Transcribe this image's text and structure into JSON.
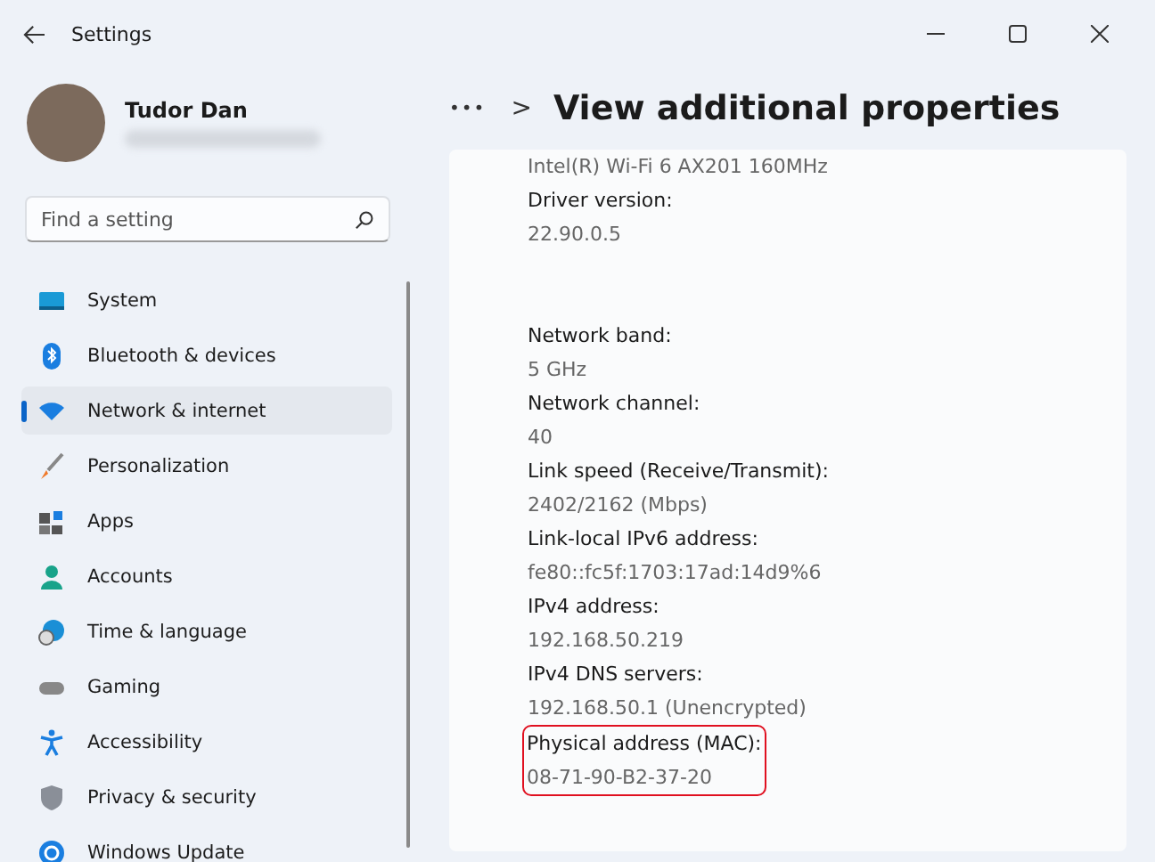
{
  "window": {
    "title": "Settings"
  },
  "profile": {
    "name": "Tudor Dan"
  },
  "search": {
    "placeholder": "Find a setting"
  },
  "nav": [
    {
      "label": "System",
      "selected": false
    },
    {
      "label": "Bluetooth & devices",
      "selected": false
    },
    {
      "label": "Network & internet",
      "selected": true
    },
    {
      "label": "Personalization",
      "selected": false
    },
    {
      "label": "Apps",
      "selected": false
    },
    {
      "label": "Accounts",
      "selected": false
    },
    {
      "label": "Time & language",
      "selected": false
    },
    {
      "label": "Gaming",
      "selected": false
    },
    {
      "label": "Accessibility",
      "selected": false
    },
    {
      "label": "Privacy & security",
      "selected": false
    },
    {
      "label": "Windows Update",
      "selected": false
    }
  ],
  "breadcrumb": {
    "overflow": "•••",
    "separator": ">",
    "title": "View additional properties"
  },
  "property_groups": [
    [
      {
        "value": "Intel(R) Wi-Fi 6 AX201 160MHz",
        "highlighted": false
      },
      {
        "label": "Driver version:",
        "value": "22.90.0.5",
        "highlighted": false
      }
    ],
    [
      {
        "label": "Network band:",
        "value": "5 GHz",
        "highlighted": false
      },
      {
        "label": "Network channel:",
        "value": "40",
        "highlighted": false
      },
      {
        "label": "Link speed (Receive/Transmit):",
        "value": "2402/2162 (Mbps)",
        "highlighted": false
      },
      {
        "label": "Link-local IPv6 address:",
        "value": "fe80::fc5f:1703:17ad:14d9%6",
        "highlighted": false
      },
      {
        "label": "IPv4 address:",
        "value": "192.168.50.219",
        "highlighted": false
      },
      {
        "label": "IPv4 DNS servers:",
        "value": "192.168.50.1 (Unencrypted)",
        "highlighted": false
      },
      {
        "label": "Physical address (MAC):",
        "value": "08-71-90-B2-37-20",
        "highlighted": true
      }
    ]
  ]
}
